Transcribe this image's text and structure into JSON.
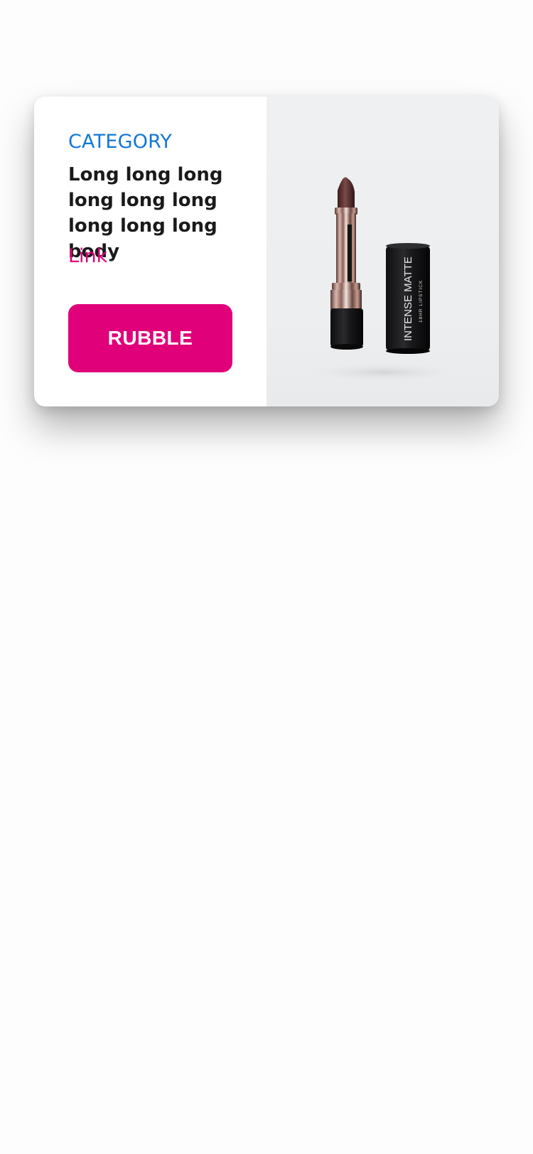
{
  "card": {
    "category": "CATEGORY",
    "body": "Long long long long long long long long long body",
    "link_label": "Link",
    "button_label": "RUBBLE",
    "image": {
      "icon": "lipstick-product-photo",
      "cap_text_large": "INTENSE MATTE",
      "cap_text_small": "18HR LIPSTICK"
    }
  },
  "colors": {
    "category": "#1277d6",
    "accent": "#e0007a",
    "body_text": "#1a1a1a"
  }
}
